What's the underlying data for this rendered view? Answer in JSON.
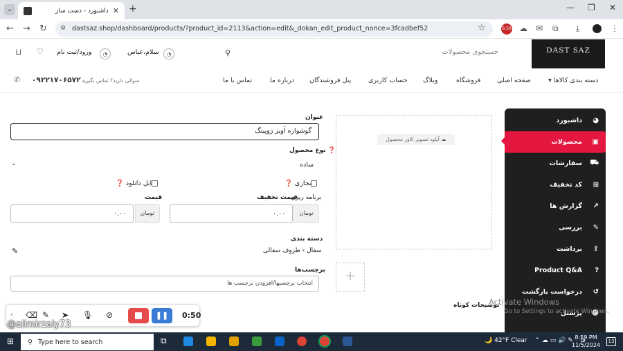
{
  "browser": {
    "tab_title": "داشبورد - دست ساز",
    "url": "dastsaz.shop/dashboard/products/?product_id=2113&action=edit&_dokan_edit_product_nonce=3fcadbef52"
  },
  "header": {
    "logo": "DAST SAZ",
    "search_placeholder": "جستجوی محصولات",
    "user_name": "سلام،عباس",
    "login": "ورود/ثبت نام"
  },
  "nav": {
    "items": [
      "دسته بندی کالاها",
      "صفحه اصلی",
      "فروشگاه",
      "وبلاگ",
      "حساب کاربری",
      "پنل فروشندگان",
      "درباره ما",
      "تماس با ما"
    ],
    "phone": "۰۹۲۲۱۷۰۶۵۷۲",
    "phone_note": "سوالی دارید؟ تماس بگیرید"
  },
  "sidebar": {
    "items": [
      "داشبورد",
      "محصولات",
      "سفارشات",
      "کد تخفیف",
      "گزارش ها",
      "بررسی",
      "برداشت",
      "Product Q&A",
      "درخواست بازگشت",
      "پرسنل"
    ],
    "active": 1
  },
  "upload": {
    "cover": "آپلود تصویر کاور محصول",
    "add": "+"
  },
  "form": {
    "title_label": "عنوان",
    "title_value": "گوشواره آویز ژوپینگ",
    "type_label": "نوع محصول",
    "type_value": "ساده",
    "virtual_label": "مجازی",
    "downloadable_label": "قابل دانلود",
    "price_label": "قیمت",
    "price_value": "۰.۰۰",
    "currency": "تومان",
    "sale_label": "قیمت تخفیف",
    "schedule_label": "برنامه ریزی",
    "sale_value": "۰.۰۰",
    "category_label": "دسته بندی",
    "category_value": "سفال › ظروف سفالی",
    "tags_label": "برچسب‌ها",
    "tags_placeholder": "انتخاب برچسبها/افزودن برچسب ها",
    "short_desc_label": "توضیحات کوتاه"
  },
  "recorder": {
    "time": "0:50",
    "watermark": "@alimirzaiy73"
  },
  "windows": {
    "activate_title": "Activate Windows",
    "activate_sub": "Go to Settings to activate Windows.",
    "search": "Type here to search",
    "temp": "42°F  Clear",
    "time": "8:59 PM",
    "date": "11/5/2024",
    "lang": "فا",
    "notif": "13"
  }
}
